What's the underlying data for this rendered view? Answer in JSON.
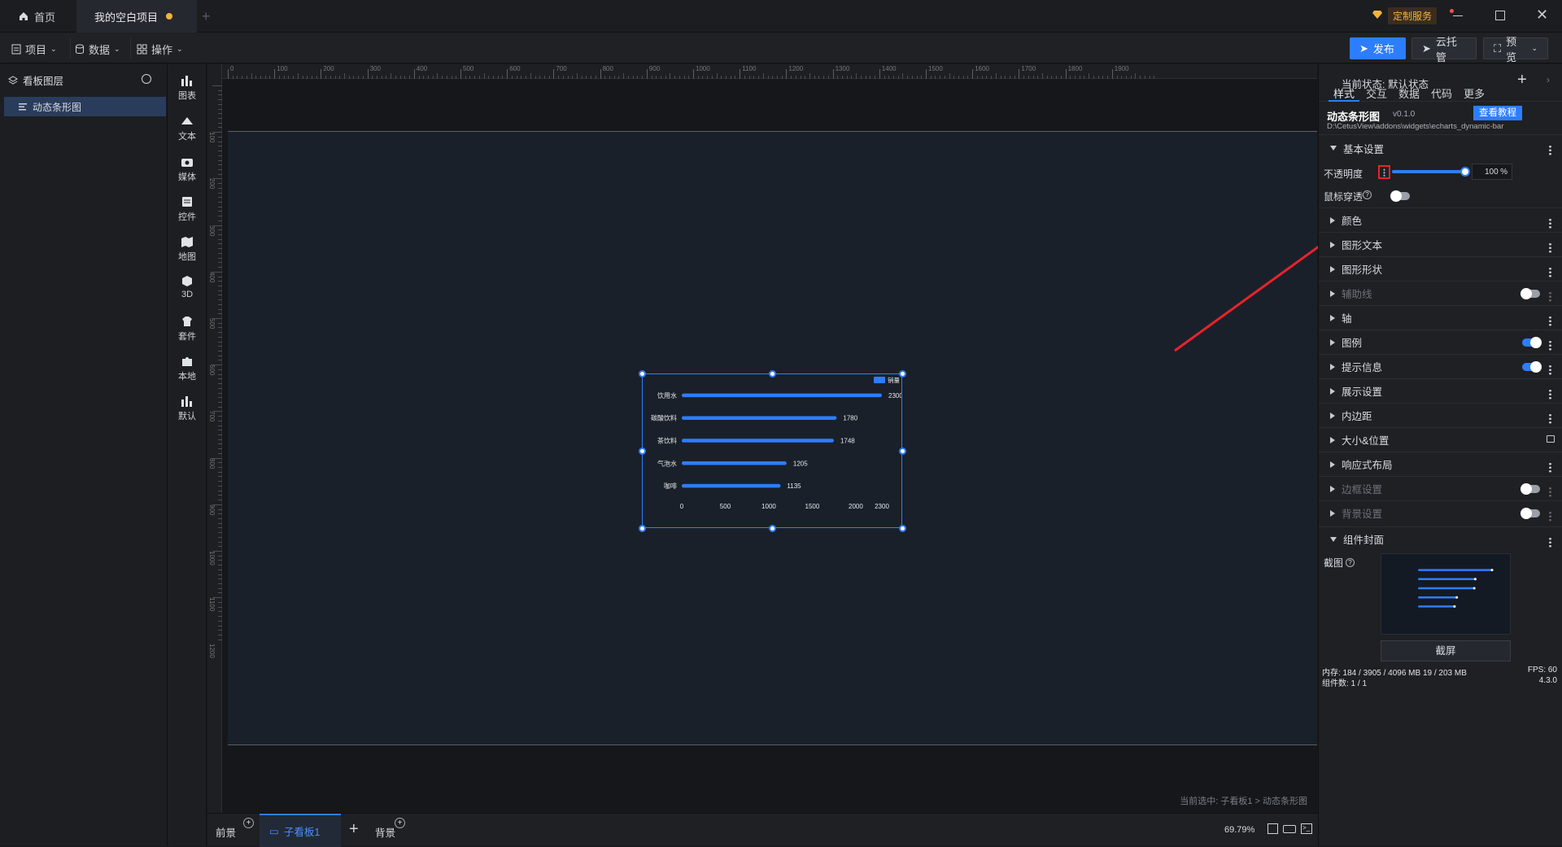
{
  "tabs": [
    {
      "label": "首页"
    },
    {
      "label": "我的空白项目"
    }
  ],
  "titlebar": {
    "service_label": "定制服务"
  },
  "menu": {
    "project": "项目",
    "data": "数据",
    "ops": "操作"
  },
  "actions": {
    "publish": "发布",
    "cloud": "云托管",
    "preview": "预览"
  },
  "layers": {
    "title": "看板图层",
    "items": [
      {
        "label": "动态条形图"
      }
    ]
  },
  "tools": [
    {
      "label": "图表",
      "icon": "chart-icon"
    },
    {
      "label": "文本",
      "icon": "text-icon"
    },
    {
      "label": "媒体",
      "icon": "media-icon"
    },
    {
      "label": "控件",
      "icon": "control-icon"
    },
    {
      "label": "地图",
      "icon": "map-icon"
    },
    {
      "label": "3D",
      "icon": "cube-icon"
    },
    {
      "label": "套件",
      "icon": "kit-icon"
    },
    {
      "label": "本地",
      "icon": "puzzle-icon"
    },
    {
      "label": "默认",
      "icon": "default-chart-icon"
    }
  ],
  "ruler": {
    "h": [
      "0",
      "100",
      "200",
      "300",
      "400",
      "500",
      "600",
      "700",
      "800",
      "900",
      "1000",
      "1100",
      "1200",
      "1300",
      "1400",
      "1500",
      "1600",
      "1700",
      "1800",
      "1900"
    ],
    "v": [
      "100",
      "200",
      "300",
      "400",
      "500",
      "600",
      "700",
      "800",
      "900",
      "1000",
      "1100",
      "1200"
    ]
  },
  "chart_data": {
    "type": "bar",
    "orientation": "horizontal",
    "legend": "销量",
    "legend_position": "top-right",
    "categories": [
      "饮用水",
      "碳酸饮料",
      "茶饮料",
      "气泡水",
      "咖啡"
    ],
    "values": [
      2300,
      1780,
      1748,
      1205,
      1135
    ],
    "x_ticks": [
      "0",
      "500",
      "1000",
      "1500",
      "2000",
      "2300"
    ],
    "xlim": [
      0,
      2300
    ],
    "grid": false
  },
  "canvas": {
    "status": "当前选中: 子看板1 > 动态条形图"
  },
  "bottom": {
    "foreground": "前景",
    "subboard": "子看板1",
    "background": "背景",
    "zoom": "69.79%",
    "memory": "内存: 184 / 3905 / 4096 MB  19 / 203 MB",
    "fps": "FPS: 60",
    "widgets": "组件数: 1 / 1",
    "version": "4.3.0"
  },
  "right": {
    "state_label": "当前状态: 默认状态",
    "tabs": [
      "样式",
      "交互",
      "数据",
      "代码",
      "更多"
    ],
    "component_name": "动态条形图",
    "version": "v0.1.0",
    "tutorial": "查看教程",
    "path": "D:\\CetusView\\addons\\widgets\\echarts_dynamic-bar",
    "basic": "基本设置",
    "opacity_label": "不透明度",
    "opacity_value": "100",
    "opacity_unit": "%",
    "opacity_level": 1.0,
    "mouse_label": "鼠标穿透",
    "sections": [
      {
        "label": "颜色",
        "state": "normal"
      },
      {
        "label": "图形文本",
        "state": "normal"
      },
      {
        "label": "图形形状",
        "state": "normal"
      },
      {
        "label": "辅助线",
        "state": "off"
      },
      {
        "label": "轴",
        "state": "normal"
      },
      {
        "label": "图例",
        "state": "on"
      },
      {
        "label": "提示信息",
        "state": "on"
      },
      {
        "label": "展示设置",
        "state": "normal"
      },
      {
        "label": "内边距",
        "state": "normal"
      },
      {
        "label": "大小&位置",
        "state": "lock"
      },
      {
        "label": "响应式布局",
        "state": "normal"
      },
      {
        "label": "边框设置",
        "state": "off"
      },
      {
        "label": "背景设置",
        "state": "off"
      }
    ],
    "cover": "组件封面",
    "snapshot_label": "截图",
    "snapshot_button": "截屏"
  },
  "colors": {
    "accent": "#2d7dff",
    "annotation": "#e8232b"
  }
}
